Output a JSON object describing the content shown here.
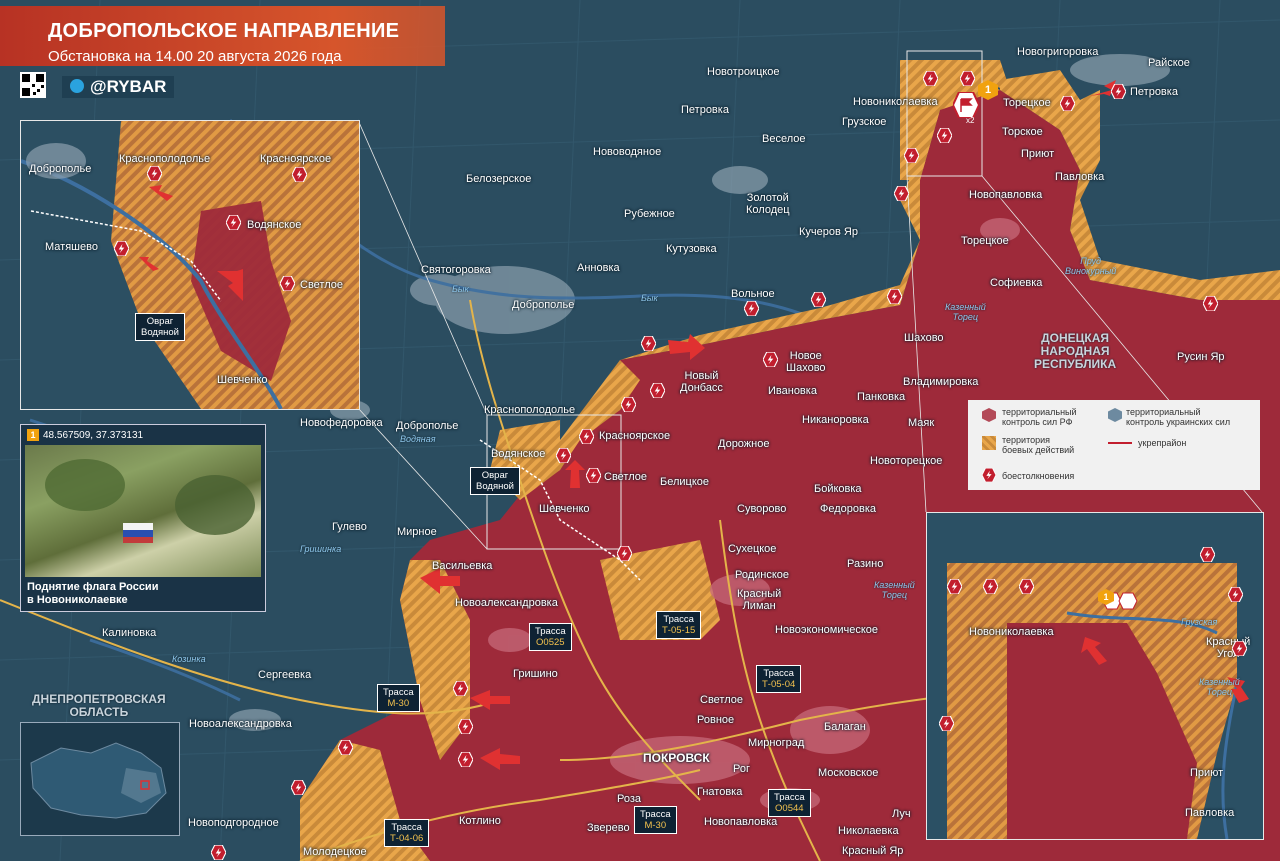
{
  "header": {
    "title": "ДОБРОПОЛЬСКОЕ НАПРАВЛЕНИЕ",
    "subtitle": "Обстановка на 14.00 20 августа 2026 года",
    "channel": "@RYBAR"
  },
  "colors": {
    "ru_control": "#9e2a3a",
    "combat_zone": "#e59c3a",
    "ua_control": "#2c4e62",
    "accent": "#d6552b",
    "road": "#e4b44a"
  },
  "icons": [
    "qr-code-icon",
    "telegram-icon",
    "clash-icon",
    "location-pin-icon",
    "flag-icon"
  ],
  "settlements": {
    "novotroitskoe": "Новотроицкое",
    "petrovka_n": "Петровка",
    "novovodyanoe": "Нововодяное",
    "beloz": "Белозерское",
    "veseloe": "Веселое",
    "zolotoy": "Золотой\nКолодец",
    "rubezhnoe": "Рубежное",
    "kutuzovka": "Кутузовка",
    "kucherov": "Кучеров Яр",
    "svyatogorovka": "Святогоровка",
    "annovka": "Анновка",
    "dobropolye": "Доброполье",
    "volnoe": "Вольное",
    "novonikolaevka": "Новониколаевка",
    "gruzskoe": "Грузское",
    "novogrigorovka": "Новогригоровка",
    "rayskoe": "Райское",
    "petrovka_ne": "Петровка",
    "toretskoe_n": "Торецкое",
    "torskoe": "Торское",
    "priyut": "Приют",
    "pavlovka": "Павловка",
    "novopavlovka_n": "Новопавловка",
    "toretskoe_s": "Торецкое",
    "sofievka": "Софиевка",
    "shakhovo": "Шахово",
    "rusin_yar": "Русин Яр",
    "novy_donbass": "Новый\nДонбасс",
    "novoe_shakhovo": "Новое\nШахово",
    "ivanovka": "Ивановка",
    "vladimirovka": "Владимировка",
    "pankovka": "Панковка",
    "nikanorovka": "Никаноровка",
    "mayak": "Маяк",
    "dorozhnoe": "Дорожное",
    "novotoretskoe": "Новоторецкое",
    "boykovka": "Бойковка",
    "fedorovka": "Федоровка",
    "krasnopodolye": "Краснополодолье",
    "krasnoyarskoe": "Красноярское",
    "novofedorovka": "Новофедоровка",
    "dobropolye2": "Доброполье",
    "vodyanskoe": "Водянское",
    "svetloe": "Светлое",
    "belitskoe": "Белицкое",
    "shevchenko": "Шевченко",
    "suvorovo": "Суворово",
    "sukhetskoe": "Сухецкое",
    "razino": "Разино",
    "rodinskoe": "Родинское",
    "krasny_liman": "Красный\nЛиман",
    "novoekonomicheskoe": "Новоэкономическое",
    "gulevo": "Гулево",
    "mirnoe": "Мирное",
    "vasilyevka": "Васильевка",
    "novoaleksandrovka": "Новоалександровка",
    "kalinovka": "Калиновка",
    "sergeevka": "Сергеевка",
    "novoaleksandrovka2": "Новоалександровка",
    "grishino": "Гришино",
    "svetloe2": "Светлое",
    "rovnoe": "Ровное",
    "pokrovsk": "ПОКРОВСК",
    "mirnograd": "Мирноград",
    "balagan": "Балаган",
    "rog": "Рог",
    "moskovskoe": "Московское",
    "gnatovka": "Гнатовка",
    "roza": "Роза",
    "novopavlovka": "Новопавловка",
    "luch": "Луч",
    "zverevo": "Зверево",
    "nikolaevka": "Николаевка",
    "krasny_yar": "Красный Яр",
    "kotlino": "Котлино",
    "novopodgorodnoe": "Новоподгородное",
    "molodetskoe": "Молодецкое",
    "matyashevo": "Матяшево"
  },
  "regions": {
    "dnr": "ДОНЕЦКАЯ\nНАРОДНАЯ\nРЕСПУБЛИКА",
    "dnepr": "ДНЕПРОПЕТРОВСКАЯ\nОБЛАСТЬ"
  },
  "rivers": {
    "byk1": "Бык",
    "byk2": "Бык",
    "kazenny1": "Казенный\nТорец",
    "kazenny2": "Казенный\nТорец",
    "kazenny3": "Казенный\nТорец",
    "vinokurny": "Пруд\nВинокурный",
    "vodyanaya": "Водяная",
    "grishinka": "Гришинка",
    "kazennyy_small": "Казенный\nТорец",
    "gruzskaya": "Грузская",
    "kazenny_inset": "Казенный\nТорец",
    "kozenka": "Козинка"
  },
  "roads": {
    "t0515": {
      "t": "Трасса",
      "n": "Т-05-15"
    },
    "o0525": {
      "t": "Трасса",
      "n": "О0525"
    },
    "m30a": {
      "t": "Трасса",
      "n": "М-30"
    },
    "t0504": {
      "t": "Трасса",
      "n": "Т-05-04"
    },
    "o0544": {
      "t": "Трасса",
      "n": "О0544"
    },
    "m30b": {
      "t": "Трасса",
      "n": "М-30"
    },
    "t0406": {
      "t": "Трасса",
      "n": "Т-04-06"
    }
  },
  "ravine": "Овраг\nВодяной",
  "inset_left": {
    "dobropolye": "Доброполье",
    "krasnopodolye": "Краснополодолье",
    "krasnoyarskoe": "Красноярское",
    "vodyanskoe": "Водянское",
    "matyashevo": "Матяшево",
    "svetloe": "Светлое",
    "ravine": "Овраг\nВодяной",
    "shevchenko": "Шевченко"
  },
  "inset_right": {
    "novonikolaevka": "Новониколаевка",
    "krasny_ugol": "Красный\nУгол",
    "priyut": "Приют",
    "pavlovka": "Павловка",
    "gruzskaya": "Грузская",
    "kazenny": "Казенный\nТорец"
  },
  "photo": {
    "coords": "48.567509, 37.373131",
    "caption": "Поднятие флага России\nв Новониколаевке",
    "badge": "1"
  },
  "marker_badge": "1",
  "marker_x2": "x2",
  "legend": {
    "ru": "территориальный\nконтроль сил РФ",
    "ua": "территориальный\nконтроль украинских сил",
    "combat": "территория\nбоевых действий",
    "fortified": "укрепрайон",
    "clash": "боестолкновения"
  }
}
